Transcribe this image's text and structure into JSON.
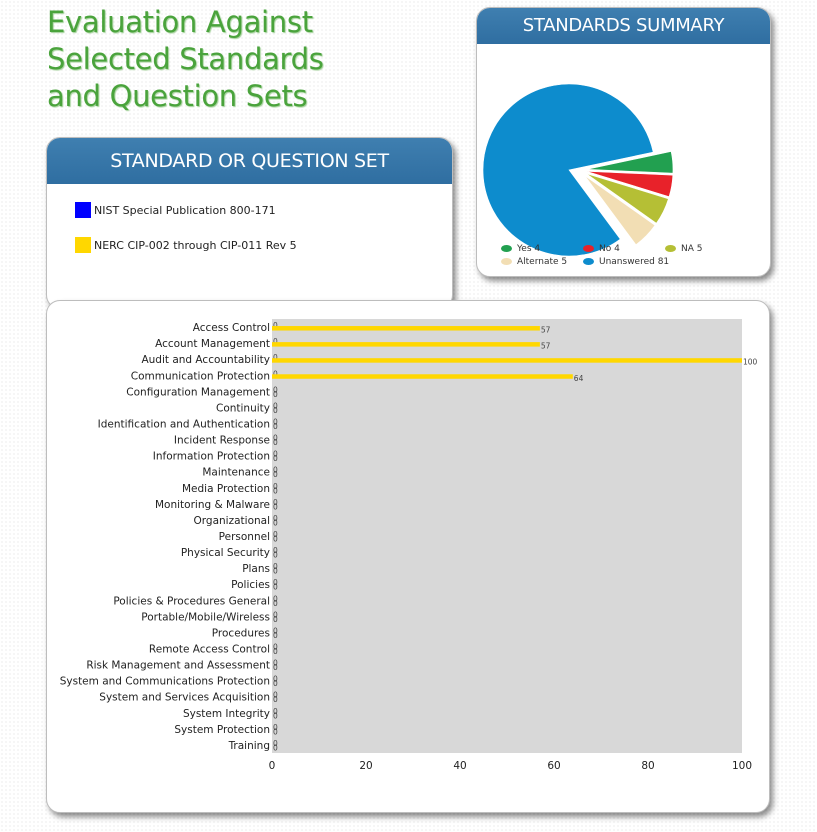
{
  "page": {
    "title": "Evaluation Against Selected Standards and Question Sets",
    "title_lines": [
      "Evaluation Against",
      "Selected Standards",
      "and Question Sets"
    ]
  },
  "summary": {
    "header": "STANDARDS SUMMARY"
  },
  "standards": {
    "header": "STANDARD OR QUESTION SET",
    "items": [
      {
        "label": "NIST Special Publication 800-171",
        "color": "#0000ff"
      },
      {
        "label": "NERC CIP-002 through CIP-011 Rev 5",
        "color": "#ffd700"
      }
    ]
  },
  "chart_data": [
    {
      "type": "pie",
      "title": "STANDARDS SUMMARY",
      "slices": [
        {
          "label": "Yes",
          "value": 4,
          "color": "#22a050",
          "legend": "Yes 4"
        },
        {
          "label": "No",
          "value": 4,
          "color": "#e8222a",
          "legend": "No 4"
        },
        {
          "label": "NA",
          "value": 5,
          "color": "#b5bf35",
          "legend": "NA 5"
        },
        {
          "label": "Alternate",
          "value": 5,
          "color": "#f2deb4",
          "legend": "Alternate 5"
        },
        {
          "label": "Unanswered",
          "value": 81,
          "color": "#0d8ccd",
          "legend": "Unanswered 81"
        }
      ],
      "legend_position": "bottom"
    },
    {
      "type": "bar",
      "orientation": "horizontal",
      "categories": [
        "Access Control",
        "Account Management",
        "Audit and Accountability",
        "Communication Protection",
        "Configuration Management",
        "Continuity",
        "Identification and Authentication",
        "Incident Response",
        "Information Protection",
        "Maintenance",
        "Media Protection",
        "Monitoring & Malware",
        "Organizational",
        "Personnel",
        "Physical Security",
        "Plans",
        "Policies",
        "Policies & Procedures General",
        "Portable/Mobile/Wireless",
        "Procedures",
        "Remote Access Control",
        "Risk Management and Assessment",
        "System and Communications Protection",
        "System and Services Acquisition",
        "System Integrity",
        "System Protection",
        "Training"
      ],
      "series": [
        {
          "name": "NIST Special Publication 800-171",
          "color": "#0000ff",
          "values": [
            0,
            0,
            0,
            0,
            0,
            0,
            0,
            0,
            0,
            0,
            0,
            0,
            0,
            0,
            0,
            0,
            0,
            0,
            0,
            0,
            0,
            0,
            0,
            0,
            0,
            0,
            0
          ]
        },
        {
          "name": "NERC CIP-002 through CIP-011 Rev 5",
          "color": "#ffd700",
          "values": [
            57,
            57,
            100,
            64,
            0,
            0,
            0,
            0,
            0,
            0,
            0,
            0,
            0,
            0,
            0,
            0,
            0,
            0,
            0,
            0,
            0,
            0,
            0,
            0,
            0,
            0,
            0
          ]
        }
      ],
      "xlim": [
        0,
        100
      ],
      "xticks": [
        0,
        20,
        40,
        60,
        80,
        100
      ],
      "grid": false
    }
  ]
}
